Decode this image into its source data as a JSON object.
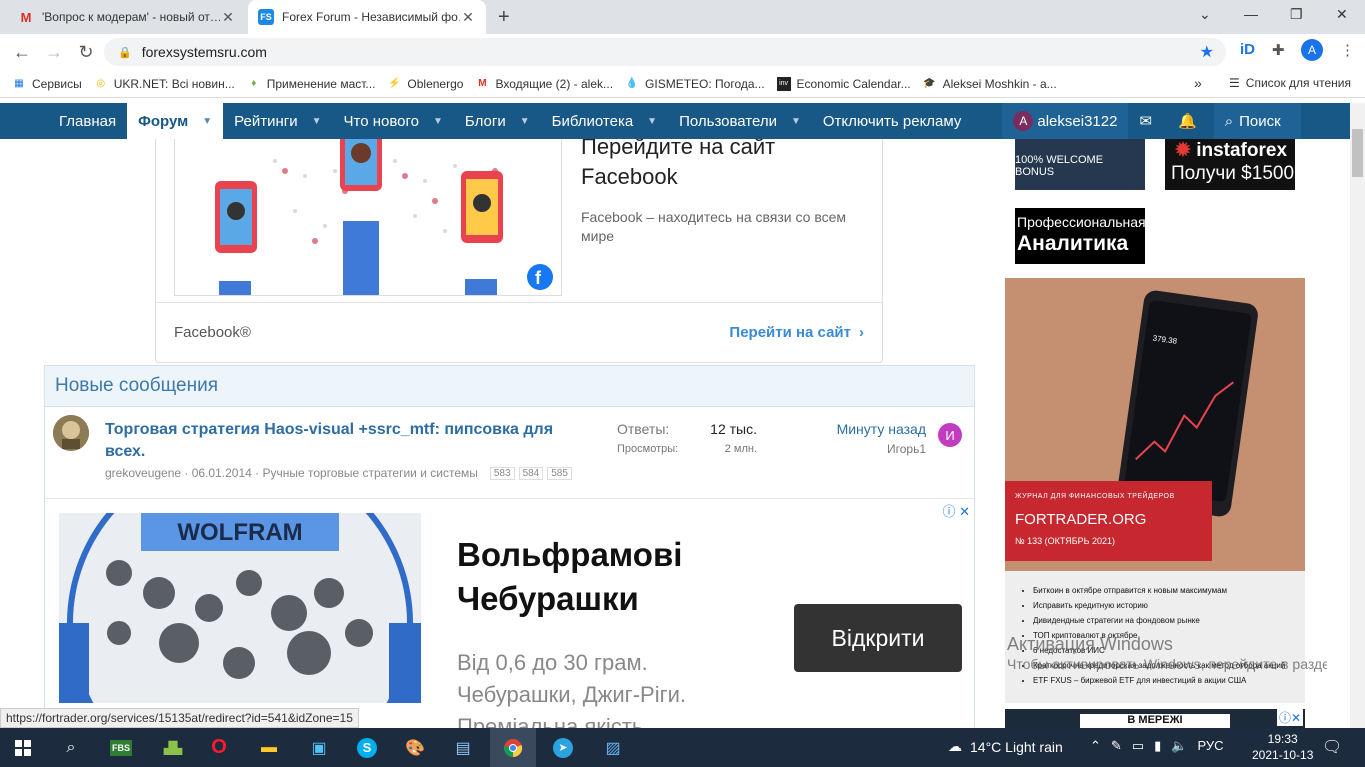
{
  "tabs": [
    {
      "title": "'Вопрос к модерам' - новый от…",
      "favicon": "gmail-icon",
      "active": false
    },
    {
      "title": "Forex Forum - Независимый фо…",
      "favicon": "forexsystems-icon",
      "active": true
    }
  ],
  "toolbar": {
    "url": "forexsystemsru.com",
    "profile_initial": "A"
  },
  "bookmarks": {
    "items": [
      "Сервисы",
      "UKR.NET: Всі новин...",
      "Применение маст...",
      "Oblenergo",
      "Входящие (2) - alek...",
      "GISMETEO: Погода...",
      "Economic Calendar...",
      "Aleksei Moshkin - a..."
    ],
    "overflow": "»",
    "reading_list": "Список для чтения"
  },
  "nav": {
    "items": [
      "Главная",
      "Форум",
      "Рейтинги",
      "Что нового",
      "Блоги",
      "Библиотека",
      "Пользователи",
      "Отключить рекламу"
    ],
    "active": "Форум",
    "user": "aleksei3122",
    "user_initial": "A",
    "search": "Поиск"
  },
  "fb_ad": {
    "title": "Перейдите на сайт Facebook",
    "desc": "Facebook – находитесь на связи со всем мире",
    "brand": "Facebook®",
    "link": "Перейти на сайт"
  },
  "new_messages": {
    "heading": "Новые сообщения",
    "thread": {
      "title": "Торговая стратегия Haos-visual +ssrc_mtf: пипсовка для всех.",
      "author": "grekoveugene",
      "date": "06.01.2014",
      "forum": "Ручные торговые стратегии и системы",
      "pages": [
        "583",
        "584",
        "585"
      ],
      "replies_label": "Ответы:",
      "replies": "12 тыс.",
      "views_label": "Просмотры:",
      "views": "2 млн.",
      "last_time": "Минуту назад",
      "last_user": "Игорь1",
      "last_initial": "И"
    }
  },
  "wolf_ad": {
    "brand": "WOLFRAM",
    "title": "Вольфрамові Чебурашки",
    "text": "Від 0,6 до 30 грам. Чебурашки, Джиг-Ріги. Преміальна якість",
    "button": "Відкрити"
  },
  "right_ads": {
    "b1": "100% WELCOME BONUS",
    "b2_l1": "instaforex",
    "b2_l2": "Получи $1500",
    "b3_l1": "Профессиональная",
    "b3_l2": "Аналитика",
    "ft_kicker": "ЖУРНАЛ ДЛЯ ФИНАНСОВЫХ ТРЕЙДЕРОВ",
    "ft_name": "FORTRADER.ORG",
    "ft_issue": "№ 133 (ОКТЯБРЬ 2021)",
    "ft_list": [
      "Биткоин в октябре отправится к новым максимумам",
      "Исправить кредитную историю",
      "Дивидендные стратегии на фондовом рынке",
      "ТОП криптовалют в октябре",
      "6 недостатков ИИС",
      "Краткосрочна кредиторская задолженность как метод отбора акций",
      "ETF FXUS – биржевой ETF для инвестиций в акции США"
    ],
    "bottom_word": "В МЕРЕЖІ"
  },
  "windows_activation": {
    "title": "Активация Windows",
    "sub": "Чтобы активировать Windows, перейдите в раздел \"Параметры\"."
  },
  "status_url": "https://fortrader.org/services/15135at/redirect?id=541&idZone=15",
  "taskbar": {
    "weather": "14°C  Light rain",
    "lang": "РУС",
    "time": "19:33",
    "date": "2021-10-13"
  }
}
